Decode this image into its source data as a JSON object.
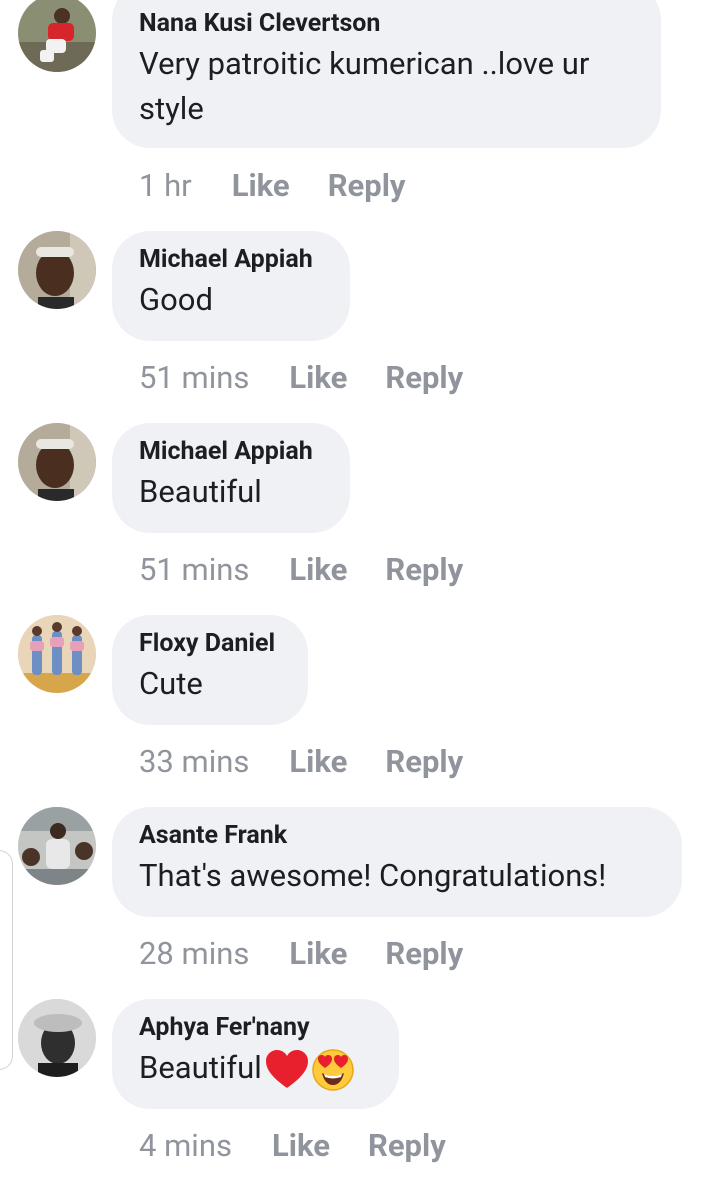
{
  "colors": {
    "bubble": "#eff1f4",
    "author": "#1c1e21",
    "meta": "#90949c"
  },
  "comments": [
    {
      "author": "Nana Kusi Clevertson",
      "text": "Very patroitic kumerican ..love ur style",
      "time": "1 hr",
      "like": "Like",
      "reply": "Reply"
    },
    {
      "author": "Michael Appiah",
      "text": "Good",
      "time": "51 mins",
      "like": "Like",
      "reply": "Reply"
    },
    {
      "author": "Michael Appiah",
      "text": "Beautiful",
      "time": "51 mins",
      "like": "Like",
      "reply": "Reply"
    },
    {
      "author": "Floxy Daniel",
      "text": "Cute",
      "time": "33 mins",
      "like": "Like",
      "reply": "Reply"
    },
    {
      "author": "Asante Frank",
      "text": "That's awesome! Congratulations!",
      "time": "28 mins",
      "like": "Like",
      "reply": "Reply"
    },
    {
      "author": "Aphya Fer'nany",
      "text": "Beautiful",
      "emoji": [
        "red-heart-icon",
        "heart-eyes-face-icon"
      ],
      "time": "4 mins",
      "like": "Like",
      "reply": "Reply"
    }
  ]
}
